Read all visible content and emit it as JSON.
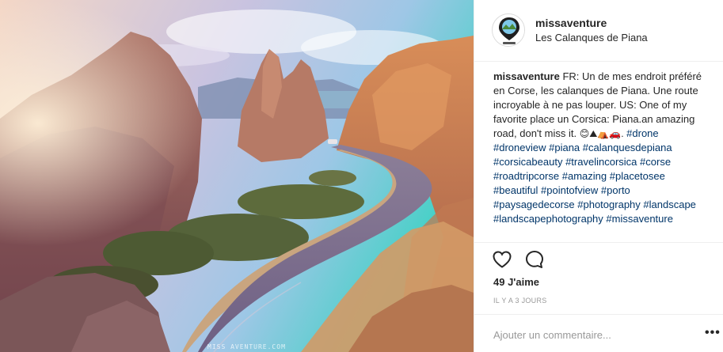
{
  "post": {
    "username": "missaventure",
    "location": "Les Calanques de Piana",
    "photo_watermark": "MISS AVENTURE.COM",
    "caption": {
      "user": "missaventure",
      "text_fr": "FR: Un de mes endroit préféré en Corse, les calanques de Piana. Une route incroyable à ne pas louper.",
      "text_us": "US: One of my favorite place un Corsica: Piana.an amazing road, don't miss it.",
      "emojis": "😊⛰⛺🚗.",
      "hashtags": [
        "#drone",
        "#droneview",
        "#piana",
        "#calanquesdepiana",
        "#corsicabeauty",
        "#travelincorsica",
        "#corse",
        "#roadtripcorse",
        "#amazing",
        "#placetosee",
        "#beautiful",
        "#pointofview",
        "#porto",
        "#paysagedecorse",
        "#photography",
        "#landscape",
        "#landscapephotography",
        "#missaventure"
      ]
    },
    "likes": "49 J'aime",
    "date": "IL Y A 3 JOURS",
    "comment_placeholder": "Ajouter un commentaire...",
    "more_label": "•••"
  },
  "icons": {
    "like": "heart-icon",
    "comment": "comment-bubble-icon",
    "more": "more-options-icon"
  },
  "colors": {
    "text": "#262626",
    "hashtag": "#003569",
    "muted": "#999999",
    "border": "#efefef"
  }
}
